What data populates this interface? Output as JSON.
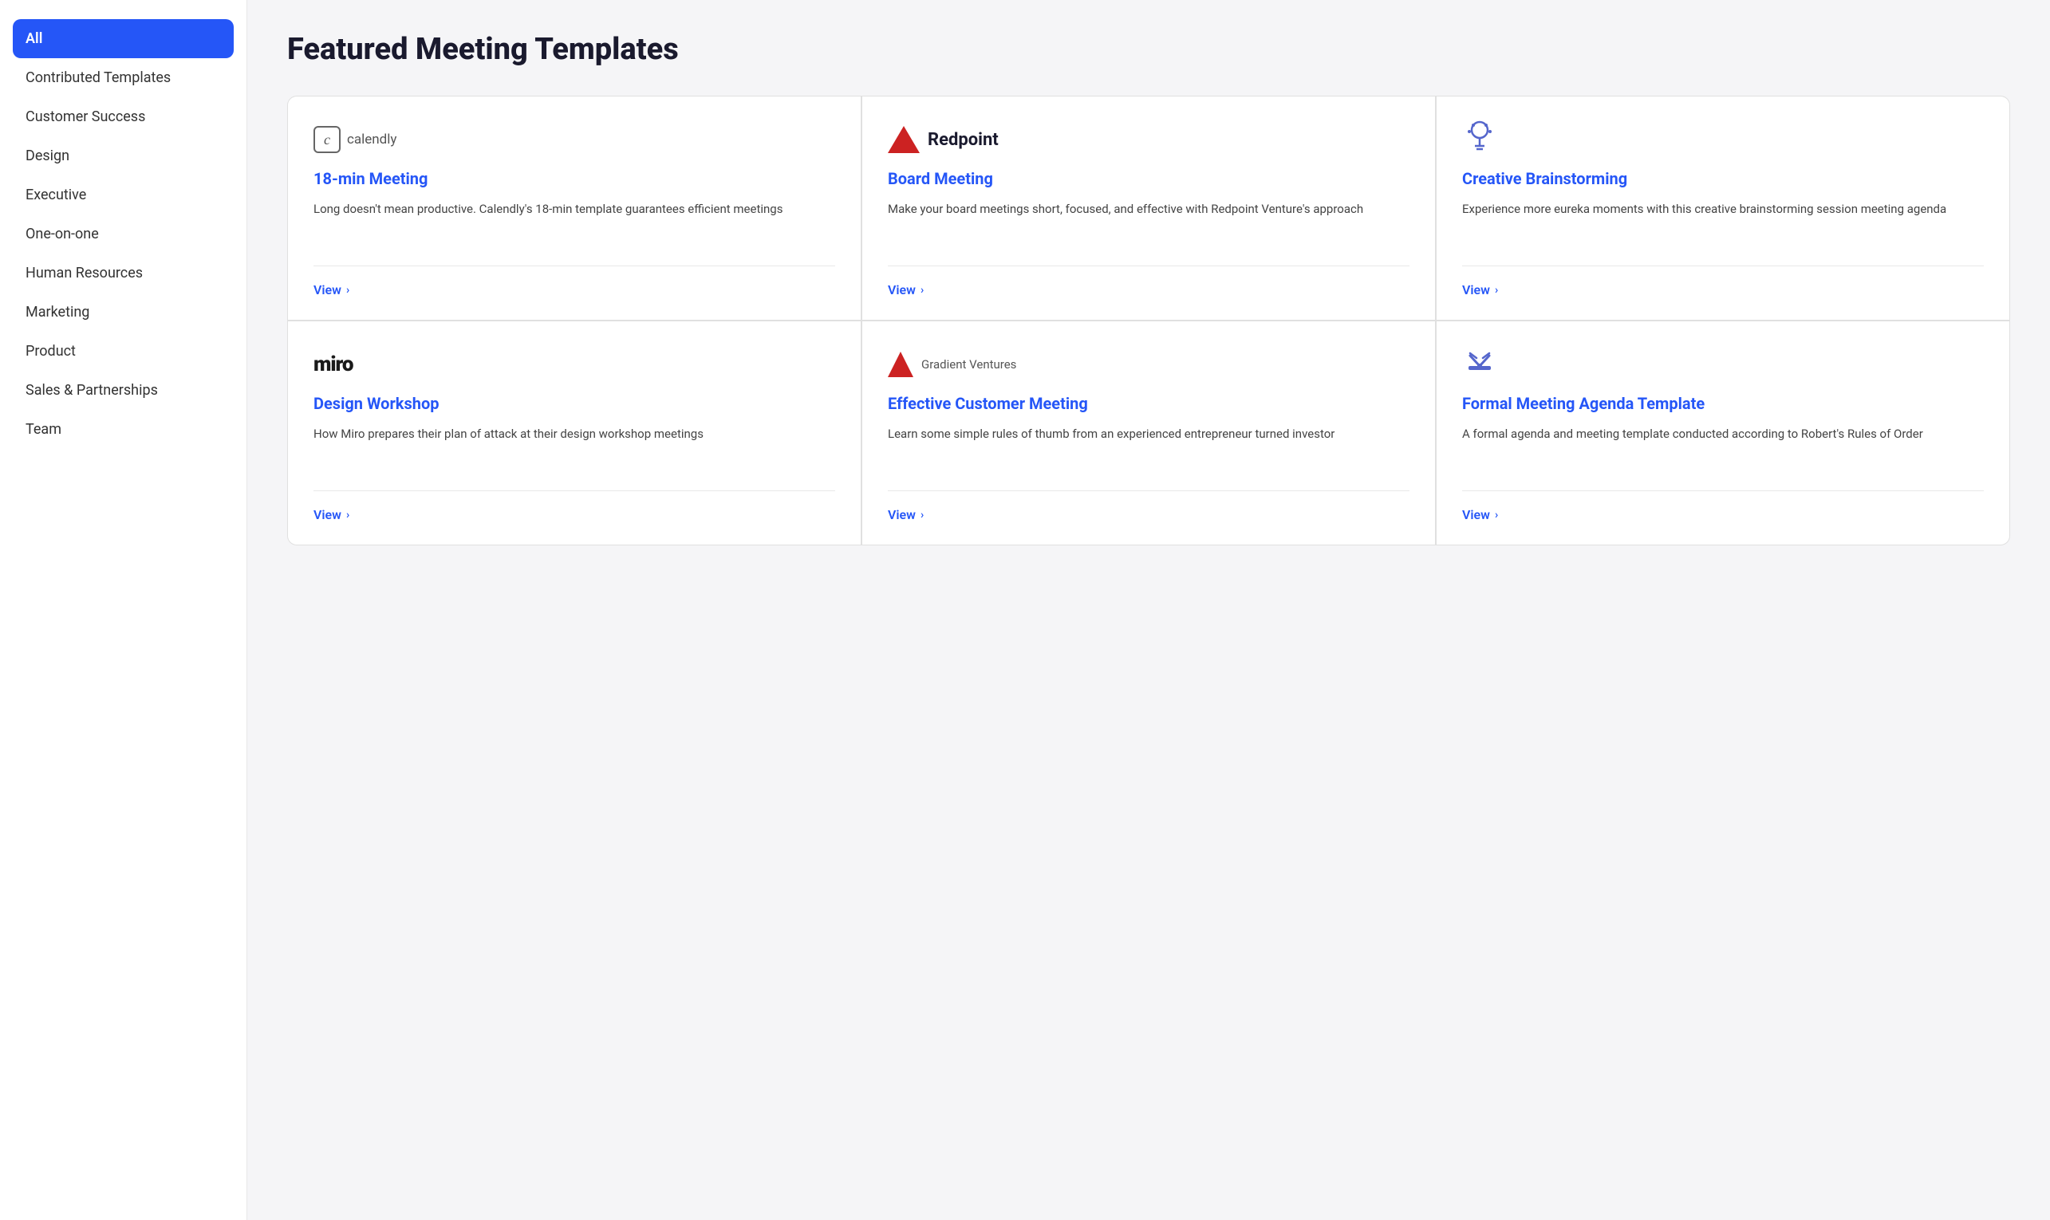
{
  "page": {
    "title": "Featured Meeting Templates"
  },
  "sidebar": {
    "items": [
      {
        "id": "all",
        "label": "All",
        "active": true
      },
      {
        "id": "contributed",
        "label": "Contributed Templates",
        "active": false
      },
      {
        "id": "customer-success",
        "label": "Customer Success",
        "active": false
      },
      {
        "id": "design",
        "label": "Design",
        "active": false
      },
      {
        "id": "executive",
        "label": "Executive",
        "active": false
      },
      {
        "id": "one-on-one",
        "label": "One-on-one",
        "active": false
      },
      {
        "id": "human-resources",
        "label": "Human Resources",
        "active": false
      },
      {
        "id": "marketing",
        "label": "Marketing",
        "active": false
      },
      {
        "id": "product",
        "label": "Product",
        "active": false
      },
      {
        "id": "sales",
        "label": "Sales & Partnerships",
        "active": false
      },
      {
        "id": "team",
        "label": "Team",
        "active": false
      }
    ]
  },
  "templates": {
    "rows": [
      [
        {
          "id": "18min",
          "logo_type": "calendly",
          "logo_text": "calendly",
          "title": "18-min Meeting",
          "description": "Long doesn't mean productive. Calendly's 18-min template guarantees efficient meetings",
          "view_label": "View"
        },
        {
          "id": "board",
          "logo_type": "redpoint",
          "logo_text": "Redpoint",
          "title": "Board Meeting",
          "description": "Make your board meetings short, focused, and effective with Redpoint Venture's approach",
          "view_label": "View"
        },
        {
          "id": "brainstorm",
          "logo_type": "brainstorm",
          "logo_text": "",
          "title": "Creative Brainstorming",
          "description": "Experience more eureka moments with this creative brainstorming session meeting agenda",
          "view_label": "View"
        }
      ],
      [
        {
          "id": "workshop",
          "logo_type": "miro",
          "logo_text": "miro",
          "title": "Design Workshop",
          "description": "How Miro prepares their plan of attack at their design workshop meetings",
          "view_label": "View"
        },
        {
          "id": "customer-meeting",
          "logo_type": "gradient",
          "logo_text": "Gradient Ventures",
          "title": "Effective Customer Meeting",
          "description": "Learn some simple rules of thumb from an experienced entrepreneur turned investor",
          "view_label": "View"
        },
        {
          "id": "formal",
          "logo_type": "formal",
          "logo_text": "",
          "title": "Formal Meeting Agenda Template",
          "description": "A formal agenda and meeting template conducted according to Robert's Rules of Order",
          "view_label": "View"
        }
      ]
    ]
  }
}
